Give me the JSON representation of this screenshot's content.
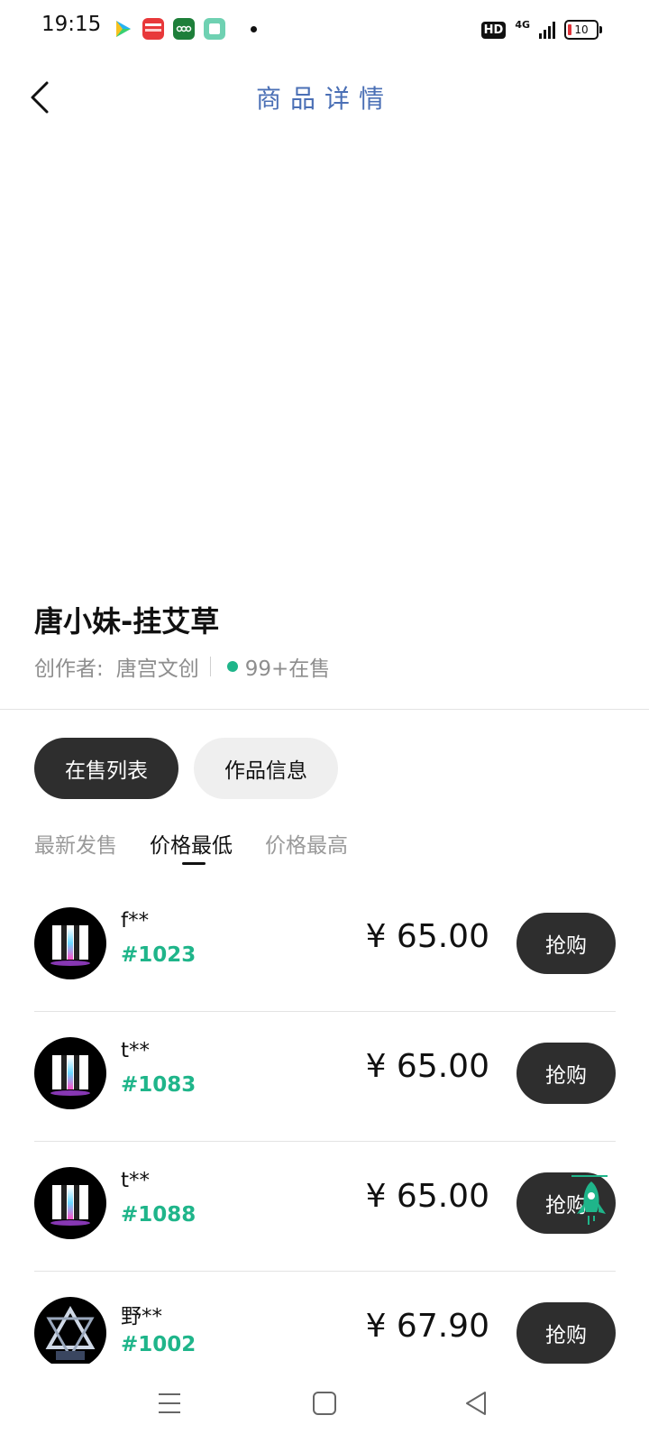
{
  "status_bar": {
    "time": "19:15",
    "hd": "HD",
    "network": "4G",
    "battery": "10",
    "icons": [
      "video-app-icon",
      "toutiao-icon",
      "oppo-app-icon",
      "notes-app-icon"
    ]
  },
  "header": {
    "title": "商品详情",
    "back_icon": "chevron-left-icon"
  },
  "product": {
    "name": "唐小妹-挂艾草",
    "creator_label": "创作者:",
    "creator": "唐宫文创",
    "on_sale": "99+在售"
  },
  "tabs": [
    {
      "label": "在售列表",
      "active": true
    },
    {
      "label": "作品信息",
      "active": false
    }
  ],
  "sort": [
    {
      "label": "最新发售",
      "active": false
    },
    {
      "label": "价格最低",
      "active": true
    },
    {
      "label": "价格最高",
      "active": false
    }
  ],
  "listings": [
    {
      "seller": "f**",
      "token": "#1023",
      "price": "¥ 65.00",
      "button": "抢购"
    },
    {
      "seller": "t**",
      "token": "#1083",
      "price": "¥ 65.00",
      "button": "抢购"
    },
    {
      "seller": "t**",
      "token": "#1088",
      "price": "¥ 65.00",
      "button": "抢购"
    },
    {
      "seller": "野**",
      "token": "#1002",
      "price": "¥ 67.90",
      "button": "抢购"
    }
  ],
  "colors": {
    "accent_green": "#1fb58a",
    "button_dark": "#2e2e2e",
    "title_blue": "#4a6fb5"
  },
  "fab_icon": "rocket-icon",
  "nav": {
    "menu_icon": "menu-icon",
    "home_icon": "home-square-icon",
    "back_icon": "triangle-back-icon"
  }
}
